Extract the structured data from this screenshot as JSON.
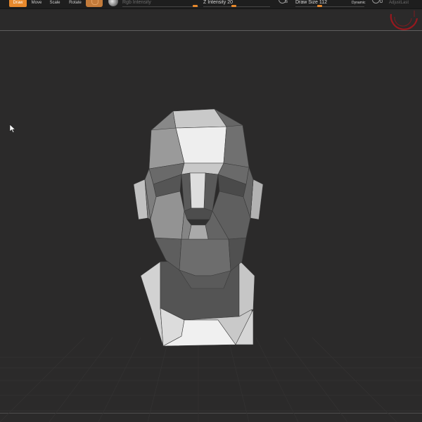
{
  "toolbar": {
    "tools": [
      {
        "label": "Draw",
        "active": true
      },
      {
        "label": "Move",
        "active": false
      },
      {
        "label": "Scale",
        "active": false
      },
      {
        "label": "Rotate",
        "active": false
      }
    ],
    "rgb_intensity_label": "Rgb Intensity",
    "z_intensity_label": "Z Intensity 20",
    "z_intensity_value": 20,
    "symmetry_letter": "S",
    "draw_size_label": "Draw Size 112",
    "draw_size_value": 112,
    "dynamic_label": "Dynamic",
    "d_letter": "D",
    "adjust_last_label": "AdjustLast"
  },
  "colors": {
    "accent": "#e8892c",
    "viewport_bg": "#2b2a2a",
    "dial": "#b3141b"
  },
  "icons": {
    "material": "material-swatch-icon",
    "sphere": "material-sphere-icon",
    "cursor": "arrow-cursor-icon",
    "dial": "rotation-dial-icon"
  }
}
